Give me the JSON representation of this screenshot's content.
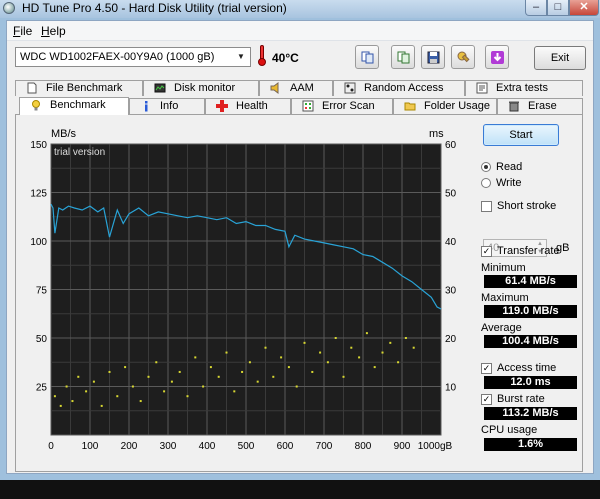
{
  "window": {
    "title": "HD Tune Pro 4.50 - Hard Disk Utility (trial version)",
    "min": "–",
    "max": "□",
    "close": "✕"
  },
  "menu": {
    "file": "File",
    "help": "Help"
  },
  "toolbar": {
    "drive": "WDC WD1002FAEX-00Y9A0 (1000 gB)",
    "temperature": "40°C",
    "buttons": [
      "copy-text-icon",
      "copy-screenshot-icon",
      "save-icon",
      "options-icon",
      "download-icon"
    ],
    "exit": "Exit"
  },
  "tabs_row1": [
    "File Benchmark",
    "Disk monitor",
    "AAM",
    "Random Access",
    "Extra tests"
  ],
  "tabs_row2": [
    "Benchmark",
    "Info",
    "Health",
    "Error Scan",
    "Folder Usage",
    "Erase"
  ],
  "active_tab": "Benchmark",
  "controls": {
    "start": "Start",
    "read": "Read",
    "write": "Write",
    "mode_selected": "Read",
    "short_stroke": "Short stroke",
    "short_stroke_checked": false,
    "stroke_value": "40",
    "stroke_unit": "gB",
    "transfer_rate": "Transfer rate",
    "transfer_rate_checked": true,
    "minimum_label": "Minimum",
    "minimum_value": "61.4 MB/s",
    "maximum_label": "Maximum",
    "maximum_value": "119.0 MB/s",
    "average_label": "Average",
    "average_value": "100.4 MB/s",
    "access_time": "Access time",
    "access_time_checked": true,
    "access_time_value": "12.0 ms",
    "burst_rate": "Burst rate",
    "burst_rate_checked": true,
    "burst_rate_value": "113.2 MB/s",
    "cpu_usage_label": "CPU usage",
    "cpu_usage_value": "1.6%"
  },
  "chart_data": {
    "type": "line",
    "watermark_text": "trial version",
    "left_axis_label": "MB/s",
    "right_axis_label": "ms",
    "x_unit": "gB",
    "xlim": [
      0,
      1000
    ],
    "ylim_left": [
      0,
      150
    ],
    "ylim_right": [
      0,
      60
    ],
    "x_ticks": [
      0,
      100,
      200,
      300,
      400,
      500,
      600,
      700,
      800,
      900,
      1000
    ],
    "y_ticks_left": [
      25,
      50,
      75,
      100,
      125,
      150
    ],
    "y_ticks_right": [
      10,
      20,
      30,
      40,
      50,
      60
    ],
    "grid": true,
    "series": [
      {
        "name": "Transfer rate",
        "axis": "left",
        "color": "#29a3d6",
        "x": [
          0,
          5,
          10,
          20,
          30,
          45,
          60,
          80,
          100,
          120,
          135,
          150,
          170,
          185,
          200,
          225,
          250,
          275,
          300,
          325,
          350,
          375,
          400,
          425,
          450,
          475,
          500,
          525,
          550,
          575,
          600,
          610,
          625,
          650,
          675,
          700,
          725,
          750,
          775,
          800,
          825,
          850,
          875,
          900,
          925,
          950,
          975,
          990,
          1000
        ],
        "y": [
          119,
          117,
          104,
          117,
          116,
          118,
          117,
          116,
          118,
          115,
          117,
          102,
          116,
          109,
          114,
          117,
          113,
          115,
          114,
          113,
          112,
          113,
          112,
          111,
          112,
          109,
          110,
          108,
          108,
          106,
          105,
          97,
          103,
          101,
          100,
          99,
          98,
          97,
          96,
          93,
          92,
          89,
          86,
          82,
          79,
          75,
          71,
          66,
          65
        ]
      },
      {
        "name": "Access time",
        "axis": "right",
        "color": "#d8d832",
        "type": "scatter",
        "x": [
          10,
          25,
          40,
          55,
          70,
          90,
          110,
          130,
          150,
          170,
          190,
          210,
          230,
          250,
          270,
          290,
          310,
          330,
          350,
          370,
          390,
          410,
          430,
          450,
          470,
          490,
          510,
          530,
          550,
          570,
          590,
          610,
          630,
          650,
          670,
          690,
          710,
          730,
          750,
          770,
          790,
          810,
          830,
          850,
          870,
          890,
          910,
          930
        ],
        "y": [
          8,
          6,
          10,
          7,
          12,
          9,
          11,
          6,
          13,
          8,
          14,
          10,
          7,
          12,
          15,
          9,
          11,
          13,
          8,
          16,
          10,
          14,
          12,
          17,
          9,
          13,
          15,
          11,
          18,
          12,
          16,
          14,
          10,
          19,
          13,
          17,
          15,
          20,
          12,
          18,
          16,
          21,
          14,
          17,
          19,
          15,
          20,
          18
        ]
      }
    ]
  }
}
